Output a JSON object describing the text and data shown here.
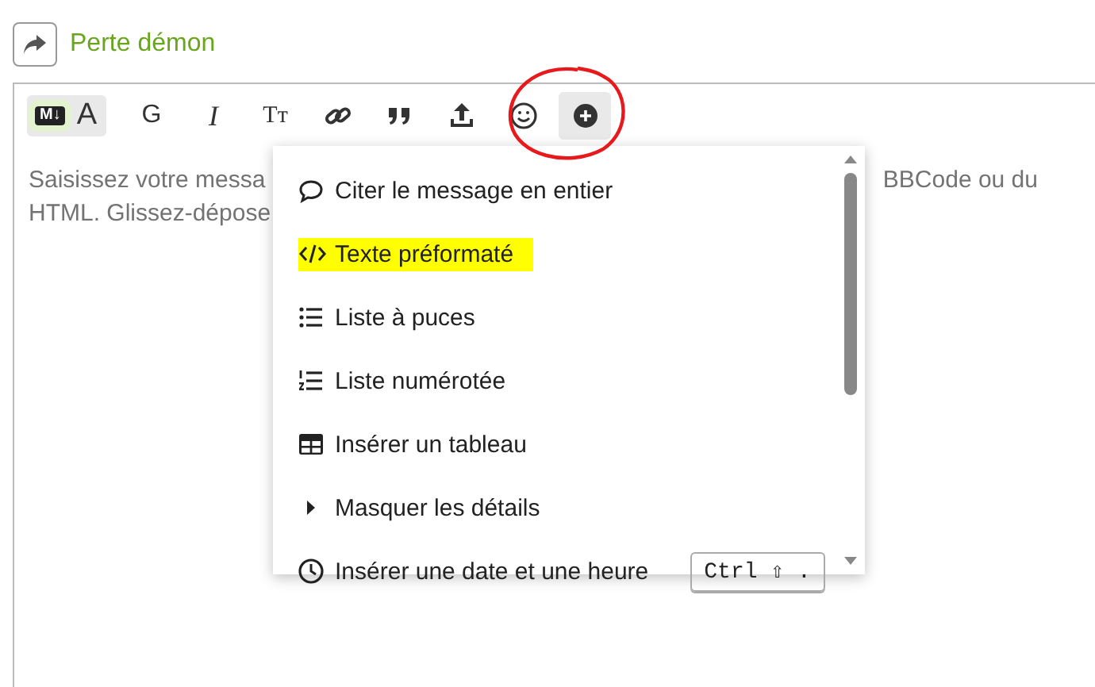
{
  "header": {
    "title": "Perte démon"
  },
  "toolbar": {
    "mode_toggle": [
      {
        "label": "M↓",
        "selected": true
      },
      {
        "label": "A",
        "selected": false
      }
    ],
    "buttons": [
      {
        "kind": "bold",
        "label": "G"
      },
      {
        "kind": "italic",
        "label": "I"
      },
      {
        "kind": "heading",
        "label": "Tт"
      },
      {
        "kind": "link"
      },
      {
        "kind": "quote"
      },
      {
        "kind": "upload"
      },
      {
        "kind": "emoji"
      },
      {
        "kind": "more",
        "selected": true
      }
    ]
  },
  "editor": {
    "placeholder_lines": [
      {
        "left": "Saisissez votre messa",
        "right": "BBCode ou du"
      },
      {
        "left": "HTML. Glissez-dépose"
      }
    ]
  },
  "menu": {
    "items": [
      {
        "kind": "quote",
        "label": "Citer le message en entier",
        "highlighted": false
      },
      {
        "kind": "code",
        "label": "Texte préformaté",
        "highlighted": true
      },
      {
        "kind": "bullets",
        "label": "Liste à puces",
        "highlighted": false
      },
      {
        "kind": "numbers",
        "label": "Liste numérotée",
        "highlighted": false
      },
      {
        "kind": "table",
        "label": "Insérer un tableau",
        "highlighted": false
      },
      {
        "kind": "details",
        "label": "Masquer les détails",
        "highlighted": false
      },
      {
        "kind": "clock",
        "label": "Insérer une date et une heure",
        "highlighted": false,
        "shortcut": "Ctrl ⇧ ."
      }
    ]
  }
}
